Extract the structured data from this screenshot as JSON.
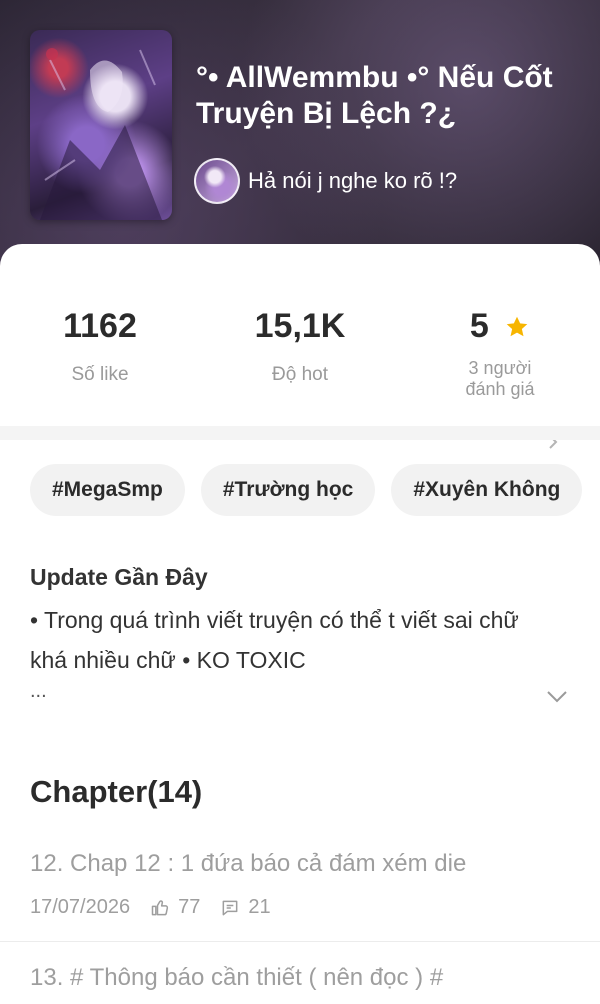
{
  "header": {
    "title": "°• AllWemmbu •° Nếu Cốt Truyện Bị Lệch ?¿",
    "author_name": "Hả nói j nghe ko rõ !?"
  },
  "stats": {
    "likes_value": "1162",
    "likes_label": "Số like",
    "hot_value": "15,1K",
    "hot_label": "Độ hot",
    "rating_value": "5",
    "rating_label_line1": "3 người",
    "rating_label_line2": "đánh giá"
  },
  "tags": [
    "#MegaSmp",
    "#Trường học",
    "#Xuyên Không"
  ],
  "update": {
    "heading": "Update Gần Đây",
    "body": "• Trong quá trình viết truyện có thể t viết sai chữ khá nhiều chữ • KO TOXIC",
    "more": "..."
  },
  "chapters": {
    "heading": "Chapter(14)",
    "items": [
      {
        "title": "12. Chap 12 : 1 đứa báo cả đám xém die",
        "date": "17/07/2026",
        "likes": "77",
        "comments": "21"
      },
      {
        "title": "13. # Thông báo cần thiết ( nên đọc ) #"
      }
    ]
  },
  "icons": {
    "star": "star-icon",
    "like": "thumbs-up-icon",
    "comment": "comment-icon",
    "chevron_right": "chevron-right-icon",
    "chevron_down": "chevron-down-icon"
  },
  "colors": {
    "star": "#f7b500",
    "muted_text": "#9e9e9e",
    "tag_bg": "#f2f2f2"
  }
}
